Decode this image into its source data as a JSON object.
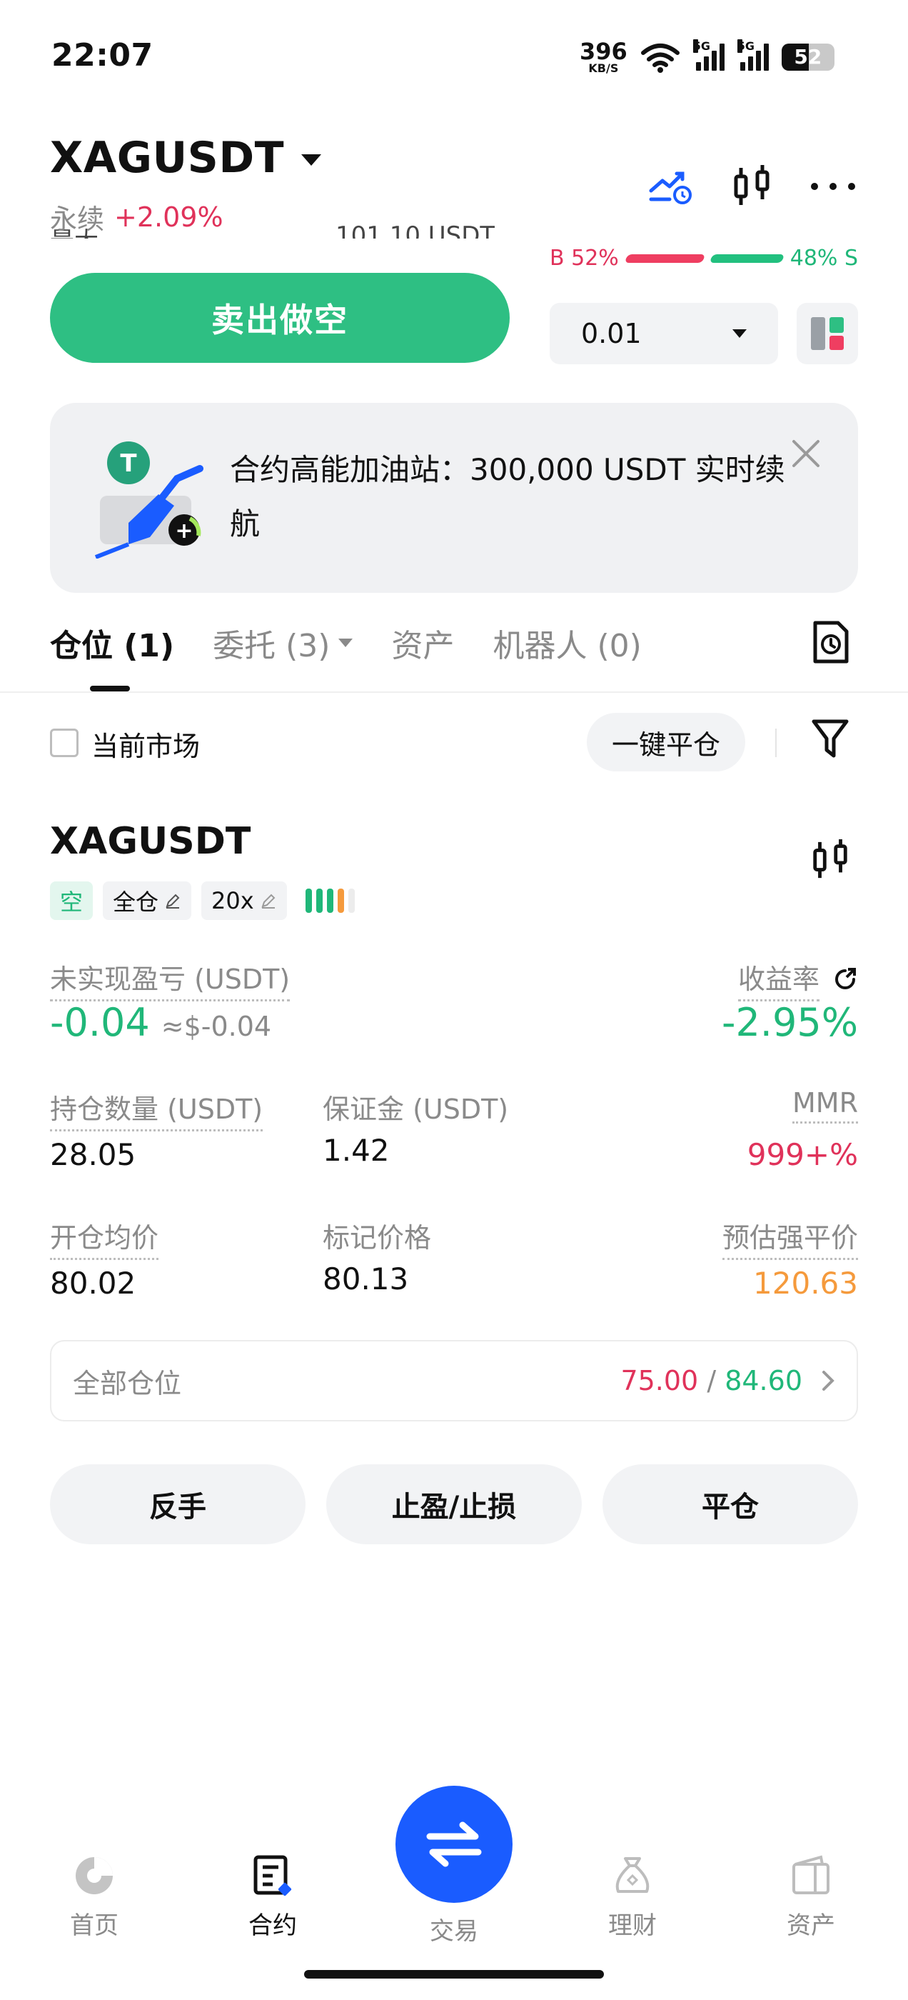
{
  "status_bar": {
    "time": "22:07",
    "net_speed": "396",
    "net_unit": "KB/S",
    "sim1": "5G",
    "sim2": "5G",
    "battery": "52"
  },
  "header": {
    "symbol": "XAGUSDT",
    "type": "永续",
    "change": "+2.09%"
  },
  "ratio": {
    "buy_label": "B 52%",
    "sell_label": "48% S",
    "buy_pct": 52,
    "sell_pct": 48
  },
  "order": {
    "sell_label": "卖出做空",
    "qty": "0.01"
  },
  "banner": {
    "text": "合约高能加油站：300,000 USDT 实时续航"
  },
  "tabs": [
    {
      "label": "仓位 (1)"
    },
    {
      "label": "委托 (3)"
    },
    {
      "label": "资产"
    },
    {
      "label": "机器人 (0)"
    }
  ],
  "filter": {
    "current_market": "当前市场",
    "close_all": "一键平仓"
  },
  "position": {
    "symbol": "XAGUSDT",
    "side": "空",
    "margin_mode": "全仓",
    "leverage": "20x",
    "unrealized_pnl_label": "未实现盈亏 (USDT)",
    "unrealized_pnl": "-0.04",
    "unrealized_pnl_approx": "≈$-0.04",
    "roe_label": "收益率",
    "roe": "-2.95%",
    "size_label": "持仓数量 (USDT)",
    "size": "28.05",
    "margin_label": "保证金 (USDT)",
    "margin": "1.42",
    "mmr_label": "MMR",
    "mmr": "999+%",
    "entry_label": "开仓均价",
    "entry": "80.02",
    "mark_label": "标记价格",
    "mark": "80.13",
    "liq_label": "预估强平价",
    "liq": "120.63"
  },
  "all_positions": {
    "label": "全部仓位",
    "value_red": "75.00",
    "sep": " / ",
    "value_green": "84.60"
  },
  "actions": {
    "reverse": "反手",
    "tpsl": "止盈/止损",
    "close": "平仓"
  },
  "nav": {
    "home": "首页",
    "futures": "合约",
    "trade": "交易",
    "earn": "理财",
    "assets": "资产"
  },
  "colors": {
    "green": "#20b779",
    "red": "#e0325a",
    "orange": "#f59a3c",
    "blue": "#1a5cff"
  }
}
